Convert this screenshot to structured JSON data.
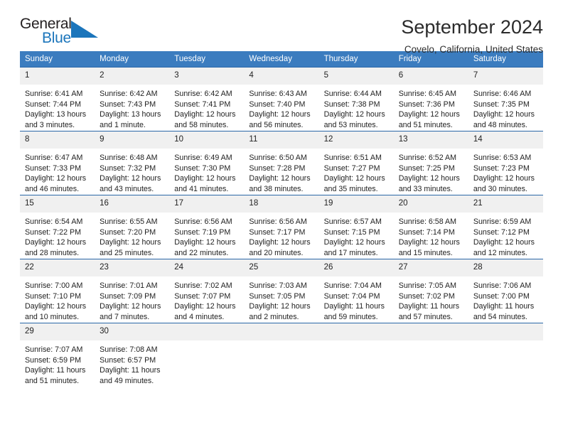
{
  "brand": {
    "name_top": "General",
    "name_bottom": "Blue",
    "triangle_color": "#1b75bb",
    "text_color": "#231f20"
  },
  "header": {
    "title": "September 2024",
    "subtitle": "Covelo, California, United States"
  },
  "colors": {
    "header_bar": "#3b7cbf",
    "row_divider": "#2a68a8",
    "daynum_band": "#f0f0f0",
    "text": "#222222"
  },
  "calendar": {
    "weekday_headers": [
      "Sunday",
      "Monday",
      "Tuesday",
      "Wednesday",
      "Thursday",
      "Friday",
      "Saturday"
    ],
    "weeks": [
      [
        {
          "day": "1",
          "sunrise": "Sunrise: 6:41 AM",
          "sunset": "Sunset: 7:44 PM",
          "daylight_1": "Daylight: 13 hours",
          "daylight_2": "and 3 minutes."
        },
        {
          "day": "2",
          "sunrise": "Sunrise: 6:42 AM",
          "sunset": "Sunset: 7:43 PM",
          "daylight_1": "Daylight: 13 hours",
          "daylight_2": "and 1 minute."
        },
        {
          "day": "3",
          "sunrise": "Sunrise: 6:42 AM",
          "sunset": "Sunset: 7:41 PM",
          "daylight_1": "Daylight: 12 hours",
          "daylight_2": "and 58 minutes."
        },
        {
          "day": "4",
          "sunrise": "Sunrise: 6:43 AM",
          "sunset": "Sunset: 7:40 PM",
          "daylight_1": "Daylight: 12 hours",
          "daylight_2": "and 56 minutes."
        },
        {
          "day": "5",
          "sunrise": "Sunrise: 6:44 AM",
          "sunset": "Sunset: 7:38 PM",
          "daylight_1": "Daylight: 12 hours",
          "daylight_2": "and 53 minutes."
        },
        {
          "day": "6",
          "sunrise": "Sunrise: 6:45 AM",
          "sunset": "Sunset: 7:36 PM",
          "daylight_1": "Daylight: 12 hours",
          "daylight_2": "and 51 minutes."
        },
        {
          "day": "7",
          "sunrise": "Sunrise: 6:46 AM",
          "sunset": "Sunset: 7:35 PM",
          "daylight_1": "Daylight: 12 hours",
          "daylight_2": "and 48 minutes."
        }
      ],
      [
        {
          "day": "8",
          "sunrise": "Sunrise: 6:47 AM",
          "sunset": "Sunset: 7:33 PM",
          "daylight_1": "Daylight: 12 hours",
          "daylight_2": "and 46 minutes."
        },
        {
          "day": "9",
          "sunrise": "Sunrise: 6:48 AM",
          "sunset": "Sunset: 7:32 PM",
          "daylight_1": "Daylight: 12 hours",
          "daylight_2": "and 43 minutes."
        },
        {
          "day": "10",
          "sunrise": "Sunrise: 6:49 AM",
          "sunset": "Sunset: 7:30 PM",
          "daylight_1": "Daylight: 12 hours",
          "daylight_2": "and 41 minutes."
        },
        {
          "day": "11",
          "sunrise": "Sunrise: 6:50 AM",
          "sunset": "Sunset: 7:28 PM",
          "daylight_1": "Daylight: 12 hours",
          "daylight_2": "and 38 minutes."
        },
        {
          "day": "12",
          "sunrise": "Sunrise: 6:51 AM",
          "sunset": "Sunset: 7:27 PM",
          "daylight_1": "Daylight: 12 hours",
          "daylight_2": "and 35 minutes."
        },
        {
          "day": "13",
          "sunrise": "Sunrise: 6:52 AM",
          "sunset": "Sunset: 7:25 PM",
          "daylight_1": "Daylight: 12 hours",
          "daylight_2": "and 33 minutes."
        },
        {
          "day": "14",
          "sunrise": "Sunrise: 6:53 AM",
          "sunset": "Sunset: 7:23 PM",
          "daylight_1": "Daylight: 12 hours",
          "daylight_2": "and 30 minutes."
        }
      ],
      [
        {
          "day": "15",
          "sunrise": "Sunrise: 6:54 AM",
          "sunset": "Sunset: 7:22 PM",
          "daylight_1": "Daylight: 12 hours",
          "daylight_2": "and 28 minutes."
        },
        {
          "day": "16",
          "sunrise": "Sunrise: 6:55 AM",
          "sunset": "Sunset: 7:20 PM",
          "daylight_1": "Daylight: 12 hours",
          "daylight_2": "and 25 minutes."
        },
        {
          "day": "17",
          "sunrise": "Sunrise: 6:56 AM",
          "sunset": "Sunset: 7:19 PM",
          "daylight_1": "Daylight: 12 hours",
          "daylight_2": "and 22 minutes."
        },
        {
          "day": "18",
          "sunrise": "Sunrise: 6:56 AM",
          "sunset": "Sunset: 7:17 PM",
          "daylight_1": "Daylight: 12 hours",
          "daylight_2": "and 20 minutes."
        },
        {
          "day": "19",
          "sunrise": "Sunrise: 6:57 AM",
          "sunset": "Sunset: 7:15 PM",
          "daylight_1": "Daylight: 12 hours",
          "daylight_2": "and 17 minutes."
        },
        {
          "day": "20",
          "sunrise": "Sunrise: 6:58 AM",
          "sunset": "Sunset: 7:14 PM",
          "daylight_1": "Daylight: 12 hours",
          "daylight_2": "and 15 minutes."
        },
        {
          "day": "21",
          "sunrise": "Sunrise: 6:59 AM",
          "sunset": "Sunset: 7:12 PM",
          "daylight_1": "Daylight: 12 hours",
          "daylight_2": "and 12 minutes."
        }
      ],
      [
        {
          "day": "22",
          "sunrise": "Sunrise: 7:00 AM",
          "sunset": "Sunset: 7:10 PM",
          "daylight_1": "Daylight: 12 hours",
          "daylight_2": "and 10 minutes."
        },
        {
          "day": "23",
          "sunrise": "Sunrise: 7:01 AM",
          "sunset": "Sunset: 7:09 PM",
          "daylight_1": "Daylight: 12 hours",
          "daylight_2": "and 7 minutes."
        },
        {
          "day": "24",
          "sunrise": "Sunrise: 7:02 AM",
          "sunset": "Sunset: 7:07 PM",
          "daylight_1": "Daylight: 12 hours",
          "daylight_2": "and 4 minutes."
        },
        {
          "day": "25",
          "sunrise": "Sunrise: 7:03 AM",
          "sunset": "Sunset: 7:05 PM",
          "daylight_1": "Daylight: 12 hours",
          "daylight_2": "and 2 minutes."
        },
        {
          "day": "26",
          "sunrise": "Sunrise: 7:04 AM",
          "sunset": "Sunset: 7:04 PM",
          "daylight_1": "Daylight: 11 hours",
          "daylight_2": "and 59 minutes."
        },
        {
          "day": "27",
          "sunrise": "Sunrise: 7:05 AM",
          "sunset": "Sunset: 7:02 PM",
          "daylight_1": "Daylight: 11 hours",
          "daylight_2": "and 57 minutes."
        },
        {
          "day": "28",
          "sunrise": "Sunrise: 7:06 AM",
          "sunset": "Sunset: 7:00 PM",
          "daylight_1": "Daylight: 11 hours",
          "daylight_2": "and 54 minutes."
        }
      ],
      [
        {
          "day": "29",
          "sunrise": "Sunrise: 7:07 AM",
          "sunset": "Sunset: 6:59 PM",
          "daylight_1": "Daylight: 11 hours",
          "daylight_2": "and 51 minutes."
        },
        {
          "day": "30",
          "sunrise": "Sunrise: 7:08 AM",
          "sunset": "Sunset: 6:57 PM",
          "daylight_1": "Daylight: 11 hours",
          "daylight_2": "and 49 minutes."
        },
        {
          "day": "",
          "sunrise": "",
          "sunset": "",
          "daylight_1": "",
          "daylight_2": ""
        },
        {
          "day": "",
          "sunrise": "",
          "sunset": "",
          "daylight_1": "",
          "daylight_2": ""
        },
        {
          "day": "",
          "sunrise": "",
          "sunset": "",
          "daylight_1": "",
          "daylight_2": ""
        },
        {
          "day": "",
          "sunrise": "",
          "sunset": "",
          "daylight_1": "",
          "daylight_2": ""
        },
        {
          "day": "",
          "sunrise": "",
          "sunset": "",
          "daylight_1": "",
          "daylight_2": ""
        }
      ]
    ]
  }
}
